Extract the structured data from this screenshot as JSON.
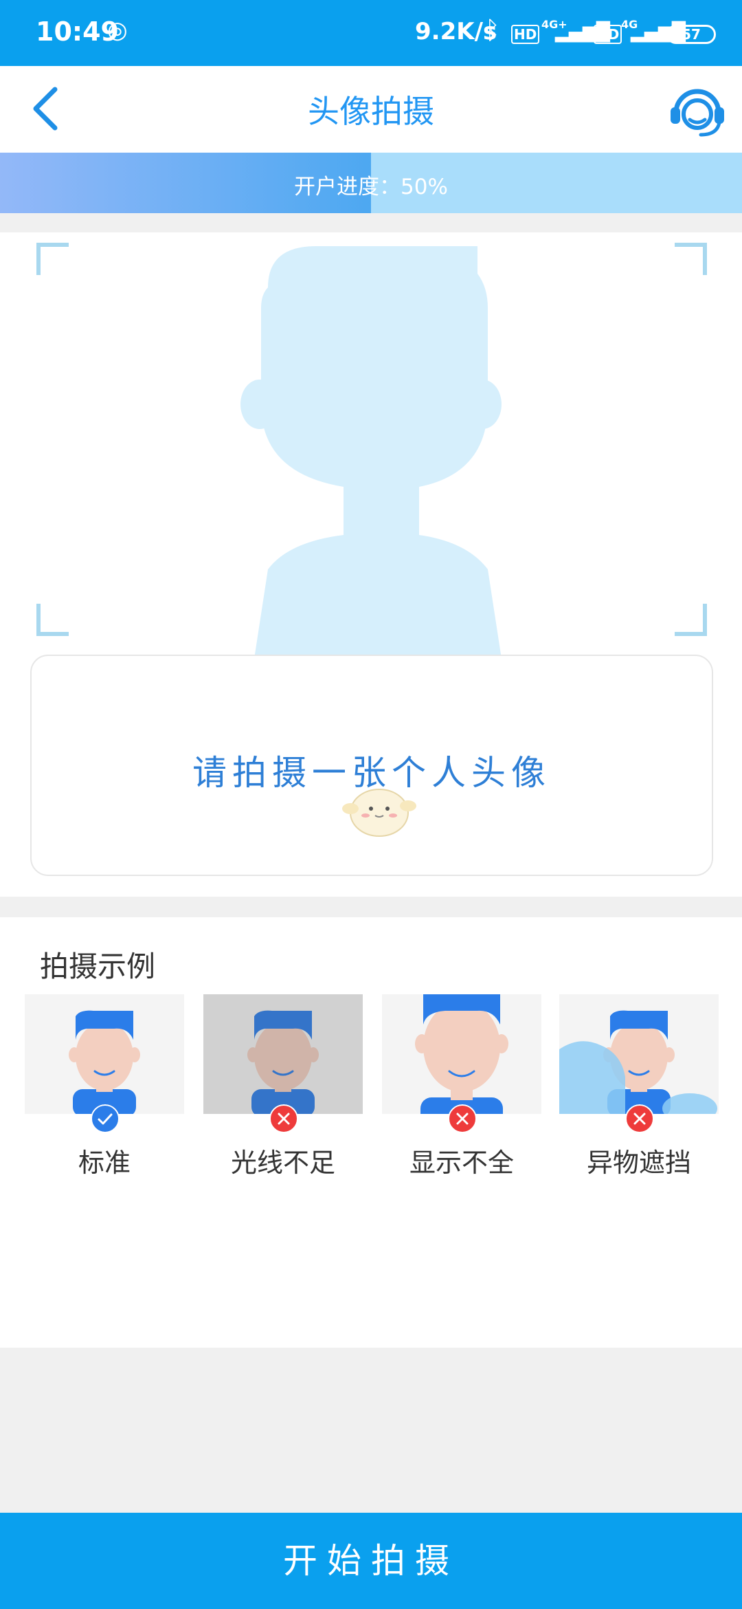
{
  "status_bar": {
    "time": "10:49",
    "net_speed": "9.2K/s",
    "sim1_type": "4G+",
    "sim2_type": "4G",
    "hd_badge": "HD",
    "battery": "57"
  },
  "nav": {
    "title": "头像拍摄",
    "back_icon": "chevron-left-icon",
    "service_icon": "headset-icon"
  },
  "progress": {
    "text": "开户进度：50%",
    "value": 0.5
  },
  "capture": {
    "prompt": "请拍摄一张个人头像"
  },
  "examples": {
    "title": "拍摄示例",
    "items": [
      {
        "label": "标准",
        "status": "ok"
      },
      {
        "label": "光线不足",
        "status": "bad"
      },
      {
        "label": "显示不全",
        "status": "bad"
      },
      {
        "label": "异物遮挡",
        "status": "bad"
      }
    ]
  },
  "bottom": {
    "start_button": "开始拍摄"
  },
  "colors": {
    "primary": "#0aa0ee",
    "title_blue": "#2196f3",
    "silhouette": "#d6effc",
    "ok": "#2b7de9",
    "error": "#ee3b3b"
  }
}
